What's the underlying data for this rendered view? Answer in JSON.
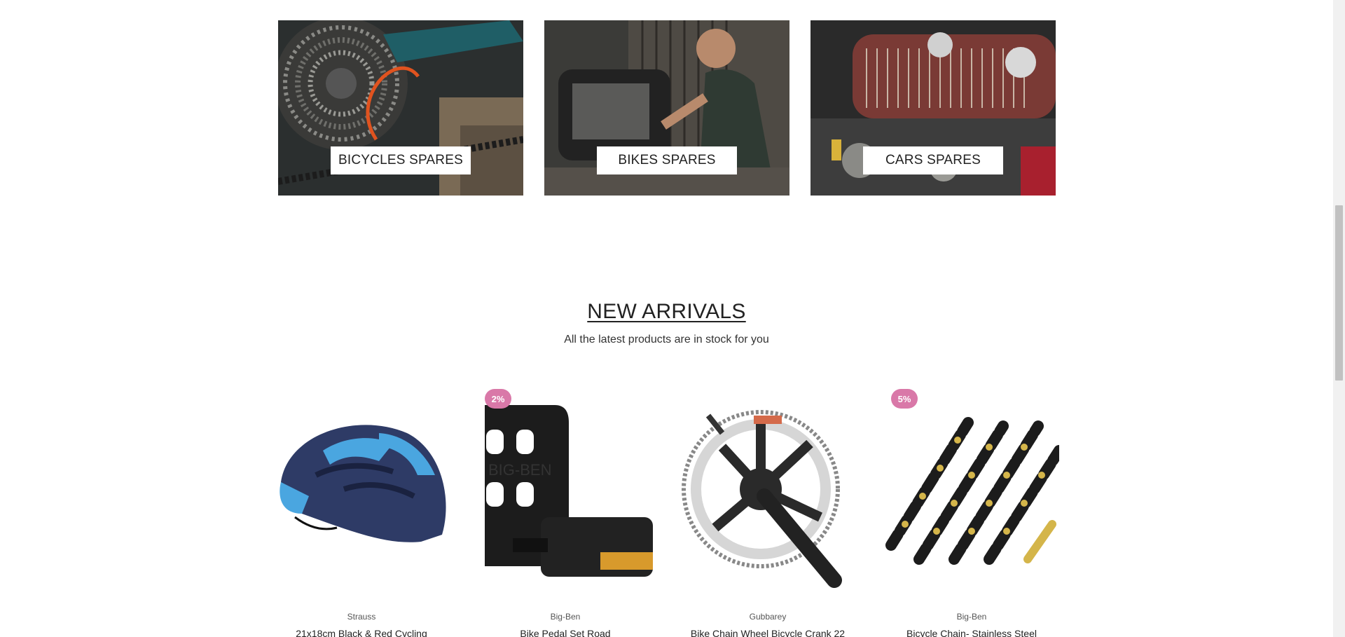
{
  "categories": [
    {
      "label": "BICYCLES SPARES",
      "icon": "bicycle-cassette-photo"
    },
    {
      "label": "BIKES SPARES",
      "icon": "motorbike-mechanic-photo"
    },
    {
      "label": "CARS SPARES",
      "icon": "car-engine-photo"
    }
  ],
  "section": {
    "title": "NEW ARRIVALS",
    "subtitle": "All the latest products are in stock for you"
  },
  "products": [
    {
      "brand": "Strauss",
      "name": "21x18cm Black & Red Cycling",
      "badge": "",
      "icon": "helmet-image"
    },
    {
      "brand": "Big-Ben",
      "name": "Bike Pedal Set Road",
      "badge": "2%",
      "icon": "pedal-image"
    },
    {
      "brand": "Gubbarey",
      "name": "Bike Chain Wheel Bicycle Crank 22",
      "badge": "",
      "icon": "crankset-image"
    },
    {
      "brand": "Big-Ben",
      "name": "Bicycle Chain- Stainless Steel",
      "badge": "5%",
      "icon": "chain-image"
    }
  ],
  "colors": {
    "badge": "#d978a8",
    "text": "#222222"
  }
}
